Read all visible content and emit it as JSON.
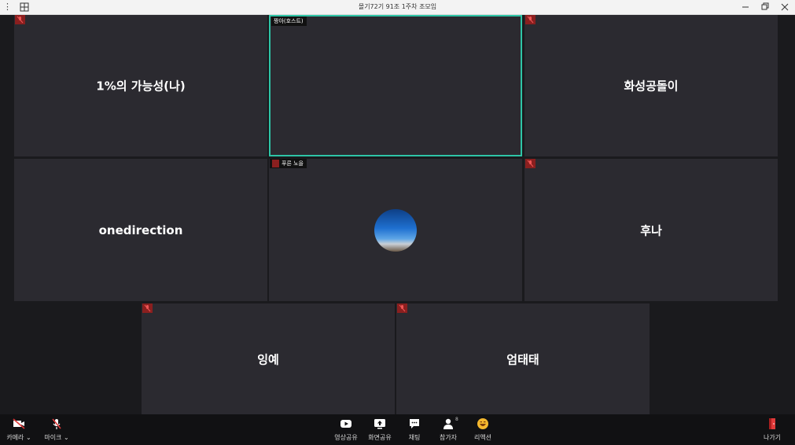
{
  "window": {
    "title": "몰기72기 91조 1주차 조모임"
  },
  "participants": [
    {
      "name": "1%의 가능성(나)",
      "muted": true
    },
    {
      "name": "",
      "tag": "짱아(호스트)",
      "active": true
    },
    {
      "name": "화성공돌이",
      "muted": true
    },
    {
      "name": "onedirection",
      "muted": false
    },
    {
      "name": "",
      "tag": "푸른 노을",
      "muted": true,
      "avatar": true
    },
    {
      "name": "후나",
      "muted": true
    },
    {
      "name": "잉예",
      "muted": true
    },
    {
      "name": "엄태태",
      "muted": true
    }
  ],
  "toolbar": {
    "camera": "카메라",
    "mic": "마이크",
    "video_share": "영상공유",
    "screen_share": "화면공유",
    "chat": "채팅",
    "participants": "참가자",
    "participants_count": "8",
    "reaction": "리액션",
    "leave": "나가기"
  },
  "colors": {
    "active_border": "#2ec4a6",
    "mute_badge": "#8a1f1f",
    "leave_icon": "#e03a3a",
    "reaction_icon": "#f5b82e"
  }
}
